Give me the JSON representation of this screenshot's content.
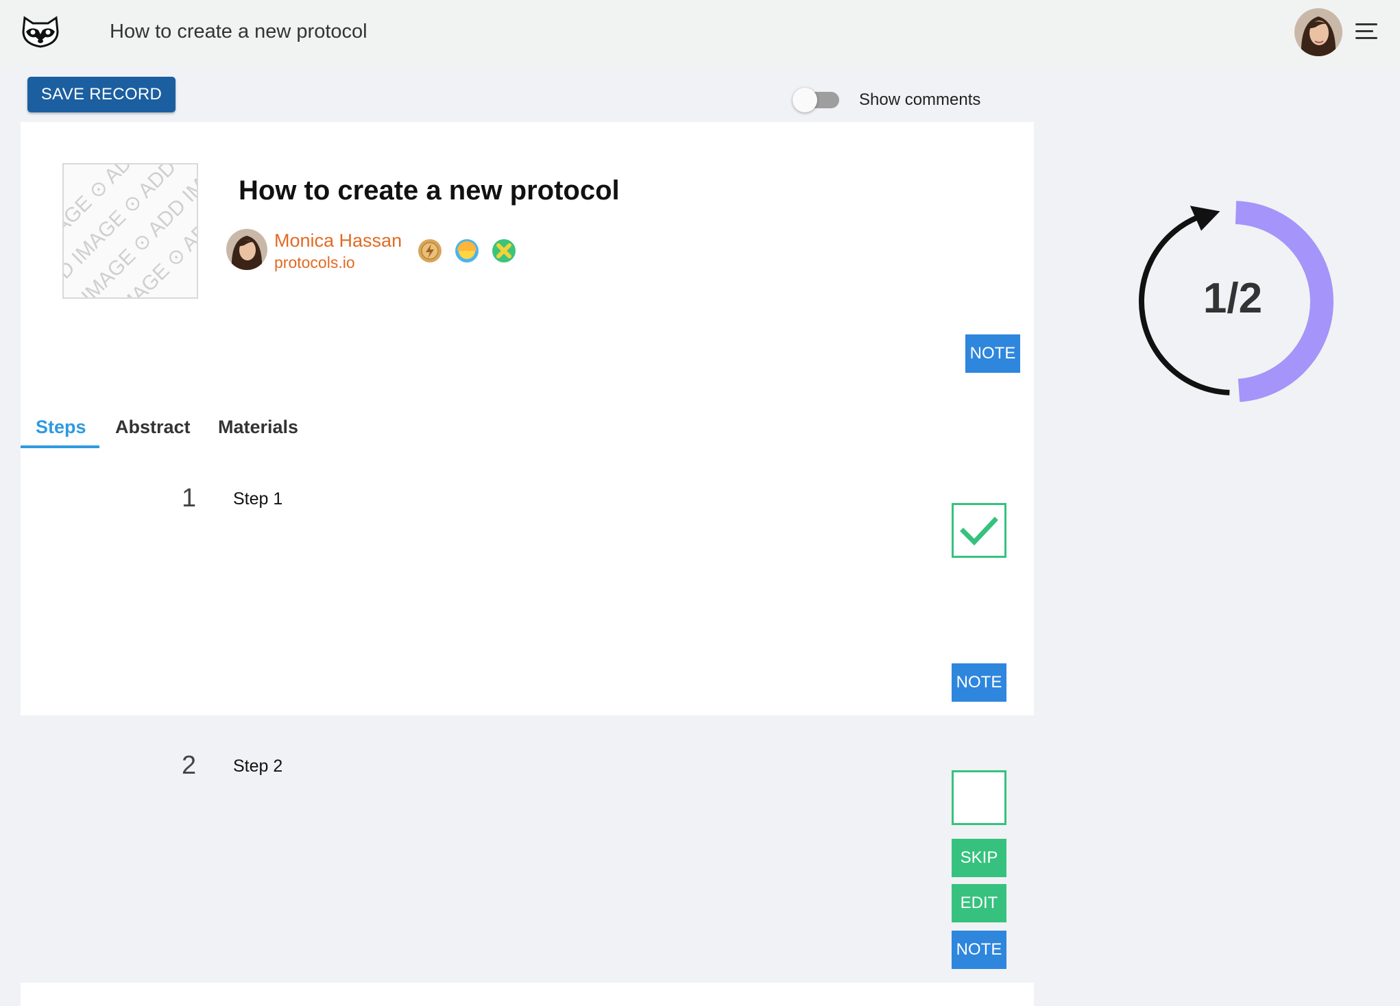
{
  "header": {
    "title": "How to create a new protocol"
  },
  "toolbar": {
    "save_label": "SAVE RECORD",
    "show_comments_label": "Show comments",
    "show_comments_enabled": false
  },
  "protocol": {
    "title": "How to create a new protocol",
    "add_image_text": "ADD IMAGE",
    "author": {
      "name": "Monica Hassan",
      "org": "protocols.io"
    },
    "note_label": "NOTE"
  },
  "tabs": [
    {
      "label": "Steps",
      "active": true
    },
    {
      "label": "Abstract",
      "active": false
    },
    {
      "label": "Materials",
      "active": false
    }
  ],
  "steps": [
    {
      "number": "1",
      "title": "Step 1",
      "completed": true,
      "note_label": "NOTE"
    },
    {
      "number": "2",
      "title": "Step 2",
      "completed": false,
      "skip_label": "SKIP",
      "edit_label": "EDIT",
      "note_label": "NOTE"
    }
  ],
  "progress": {
    "label": "1/2",
    "completed": 1,
    "total": 2
  },
  "colors": {
    "primary_dark": "#1b5fa0",
    "note_blue": "#2f86dd",
    "tab_active": "#2f9ae0",
    "author_orange": "#e26a22",
    "success_green": "#36c27e",
    "progress_purple": "#a594f9"
  },
  "icons": [
    "raccoon-logo-icon",
    "menu-icon",
    "camera-icon",
    "lightning-badge-icon",
    "sun-badge-icon",
    "x-badge-icon",
    "checkmark-icon"
  ]
}
